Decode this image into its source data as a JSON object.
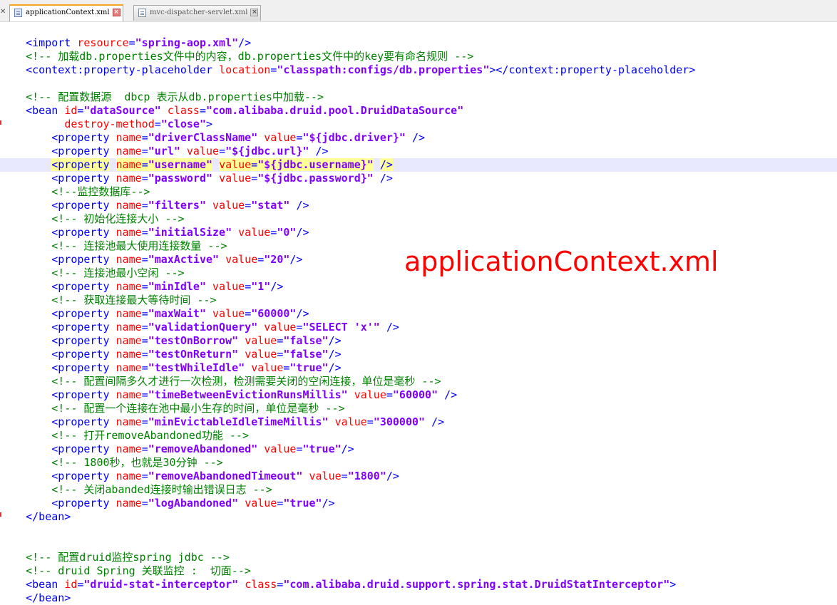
{
  "colors": {
    "tag": "#0000ff",
    "attribute": "#ff0000",
    "value": "#8000ff",
    "comment": "#008000",
    "highlight_line": "#e8e8ff",
    "overlay": "#ff0000"
  },
  "tabs": [
    {
      "label": "applicationContext.xml",
      "active": true,
      "icon": "xml-file-icon"
    },
    {
      "label": "mvc-dispatcher-servlet.xml",
      "active": false,
      "icon": "xml-file-icon"
    }
  ],
  "overlay_text": "applicationContext.xml",
  "lines": [
    [],
    [
      {
        "t": "text",
        "v": "    "
      },
      {
        "t": "tag",
        "v": "<import"
      },
      {
        "t": "text",
        "v": " "
      },
      {
        "t": "attr",
        "v": "resource"
      },
      {
        "t": "tag",
        "v": "="
      },
      {
        "t": "val",
        "v": "\"spring-aop.xml\""
      },
      {
        "t": "tag",
        "v": "/>"
      }
    ],
    [
      {
        "t": "text",
        "v": "    "
      },
      {
        "t": "comment",
        "v": "<!-- 加载db.properties文件中的内容，db.properties文件中的key要有命名规则 -->"
      }
    ],
    [
      {
        "t": "text",
        "v": "    "
      },
      {
        "t": "tag",
        "v": "<context:property-placeholder"
      },
      {
        "t": "text",
        "v": " "
      },
      {
        "t": "attr",
        "v": "location"
      },
      {
        "t": "tag",
        "v": "="
      },
      {
        "t": "val",
        "v": "\"classpath:configs/db.properties\""
      },
      {
        "t": "tag",
        "v": "></context:property-placeholder>"
      }
    ],
    [],
    [
      {
        "t": "text",
        "v": "    "
      },
      {
        "t": "comment",
        "v": "<!-- 配置数据源  dbcp 表示从db.properties中加载-->"
      }
    ],
    [
      {
        "t": "text",
        "v": "    "
      },
      {
        "t": "tag",
        "v": "<bean"
      },
      {
        "t": "text",
        "v": " "
      },
      {
        "t": "attr",
        "v": "id"
      },
      {
        "t": "tag",
        "v": "="
      },
      {
        "t": "val",
        "v": "\"dataSource\""
      },
      {
        "t": "text",
        "v": " "
      },
      {
        "t": "attr",
        "v": "class"
      },
      {
        "t": "tag",
        "v": "="
      },
      {
        "t": "val",
        "v": "\"com.alibaba.druid.pool.DruidDataSource\""
      }
    ],
    [
      {
        "t": "text",
        "v": "          "
      },
      {
        "t": "attr",
        "v": "destroy-method"
      },
      {
        "t": "tag",
        "v": "="
      },
      {
        "t": "val",
        "v": "\"close\""
      },
      {
        "t": "tag",
        "v": ">"
      }
    ],
    [
      {
        "t": "text",
        "v": "        "
      },
      {
        "t": "tag",
        "v": "<property"
      },
      {
        "t": "text",
        "v": " "
      },
      {
        "t": "attr",
        "v": "name"
      },
      {
        "t": "tag",
        "v": "="
      },
      {
        "t": "val",
        "v": "\"driverClassName\""
      },
      {
        "t": "text",
        "v": " "
      },
      {
        "t": "attr",
        "v": "value"
      },
      {
        "t": "tag",
        "v": "="
      },
      {
        "t": "val",
        "v": "\"${jdbc.driver}\""
      },
      {
        "t": "text",
        "v": " "
      },
      {
        "t": "tag",
        "v": "/>"
      }
    ],
    [
      {
        "t": "text",
        "v": "        "
      },
      {
        "t": "tag",
        "v": "<property"
      },
      {
        "t": "text",
        "v": " "
      },
      {
        "t": "attr",
        "v": "name"
      },
      {
        "t": "tag",
        "v": "="
      },
      {
        "t": "val",
        "v": "\"url\""
      },
      {
        "t": "text",
        "v": " "
      },
      {
        "t": "attr",
        "v": "value"
      },
      {
        "t": "tag",
        "v": "="
      },
      {
        "t": "val",
        "v": "\"${jdbc.url}\""
      },
      {
        "t": "text",
        "v": " "
      },
      {
        "t": "tag",
        "v": "/>"
      }
    ],
    [
      {
        "t": "text",
        "v": "        "
      },
      {
        "t": "tag",
        "v": "<property",
        "s": 1
      },
      {
        "t": "text",
        "v": " "
      },
      {
        "t": "attr",
        "v": "name",
        "s": 1
      },
      {
        "t": "tag",
        "v": "=",
        "s": 1
      },
      {
        "t": "val",
        "v": "\"username\"",
        "s": 1
      },
      {
        "t": "text",
        "v": " "
      },
      {
        "t": "attr",
        "v": "value",
        "s": 1
      },
      {
        "t": "tag",
        "v": "=",
        "s": 1
      },
      {
        "t": "val",
        "v": "\"${jdbc.username}\"",
        "s": 1
      },
      {
        "t": "text",
        "v": " "
      },
      {
        "t": "tag",
        "v": "/>",
        "s": 1
      }
    ],
    [
      {
        "t": "text",
        "v": "        "
      },
      {
        "t": "tag",
        "v": "<property"
      },
      {
        "t": "text",
        "v": " "
      },
      {
        "t": "attr",
        "v": "name"
      },
      {
        "t": "tag",
        "v": "="
      },
      {
        "t": "val",
        "v": "\"password\""
      },
      {
        "t": "text",
        "v": " "
      },
      {
        "t": "attr",
        "v": "value"
      },
      {
        "t": "tag",
        "v": "="
      },
      {
        "t": "val",
        "v": "\"${jdbc.password}\""
      },
      {
        "t": "text",
        "v": " "
      },
      {
        "t": "tag",
        "v": "/>"
      }
    ],
    [
      {
        "t": "text",
        "v": "        "
      },
      {
        "t": "comment",
        "v": "<!--监控数据库-->"
      }
    ],
    [
      {
        "t": "text",
        "v": "        "
      },
      {
        "t": "tag",
        "v": "<property"
      },
      {
        "t": "text",
        "v": " "
      },
      {
        "t": "attr",
        "v": "name"
      },
      {
        "t": "tag",
        "v": "="
      },
      {
        "t": "val",
        "v": "\"filters\""
      },
      {
        "t": "text",
        "v": " "
      },
      {
        "t": "attr",
        "v": "value"
      },
      {
        "t": "tag",
        "v": "="
      },
      {
        "t": "val",
        "v": "\"stat\""
      },
      {
        "t": "text",
        "v": " "
      },
      {
        "t": "tag",
        "v": "/>"
      }
    ],
    [
      {
        "t": "text",
        "v": "        "
      },
      {
        "t": "comment",
        "v": "<!-- 初始化连接大小 -->"
      }
    ],
    [
      {
        "t": "text",
        "v": "        "
      },
      {
        "t": "tag",
        "v": "<property"
      },
      {
        "t": "text",
        "v": " "
      },
      {
        "t": "attr",
        "v": "name"
      },
      {
        "t": "tag",
        "v": "="
      },
      {
        "t": "val",
        "v": "\"initialSize\""
      },
      {
        "t": "text",
        "v": " "
      },
      {
        "t": "attr",
        "v": "value"
      },
      {
        "t": "tag",
        "v": "="
      },
      {
        "t": "val",
        "v": "\"0\""
      },
      {
        "t": "tag",
        "v": "/>"
      }
    ],
    [
      {
        "t": "text",
        "v": "        "
      },
      {
        "t": "comment",
        "v": "<!-- 连接池最大使用连接数量 -->"
      }
    ],
    [
      {
        "t": "text",
        "v": "        "
      },
      {
        "t": "tag",
        "v": "<property"
      },
      {
        "t": "text",
        "v": " "
      },
      {
        "t": "attr",
        "v": "name"
      },
      {
        "t": "tag",
        "v": "="
      },
      {
        "t": "val",
        "v": "\"maxActive\""
      },
      {
        "t": "text",
        "v": " "
      },
      {
        "t": "attr",
        "v": "value"
      },
      {
        "t": "tag",
        "v": "="
      },
      {
        "t": "val",
        "v": "\"20\""
      },
      {
        "t": "tag",
        "v": "/>"
      }
    ],
    [
      {
        "t": "text",
        "v": "        "
      },
      {
        "t": "comment",
        "v": "<!-- 连接池最小空闲 -->"
      }
    ],
    [
      {
        "t": "text",
        "v": "        "
      },
      {
        "t": "tag",
        "v": "<property"
      },
      {
        "t": "text",
        "v": " "
      },
      {
        "t": "attr",
        "v": "name"
      },
      {
        "t": "tag",
        "v": "="
      },
      {
        "t": "val",
        "v": "\"minIdle\""
      },
      {
        "t": "text",
        "v": " "
      },
      {
        "t": "attr",
        "v": "value"
      },
      {
        "t": "tag",
        "v": "="
      },
      {
        "t": "val",
        "v": "\"1\""
      },
      {
        "t": "tag",
        "v": "/>"
      }
    ],
    [
      {
        "t": "text",
        "v": "        "
      },
      {
        "t": "comment",
        "v": "<!-- 获取连接最大等待时间 -->"
      }
    ],
    [
      {
        "t": "text",
        "v": "        "
      },
      {
        "t": "tag",
        "v": "<property"
      },
      {
        "t": "text",
        "v": " "
      },
      {
        "t": "attr",
        "v": "name"
      },
      {
        "t": "tag",
        "v": "="
      },
      {
        "t": "val",
        "v": "\"maxWait\""
      },
      {
        "t": "text",
        "v": " "
      },
      {
        "t": "attr",
        "v": "value"
      },
      {
        "t": "tag",
        "v": "="
      },
      {
        "t": "val",
        "v": "\"60000\""
      },
      {
        "t": "tag",
        "v": "/>"
      }
    ],
    [
      {
        "t": "text",
        "v": "        "
      },
      {
        "t": "tag",
        "v": "<property"
      },
      {
        "t": "text",
        "v": " "
      },
      {
        "t": "attr",
        "v": "name"
      },
      {
        "t": "tag",
        "v": "="
      },
      {
        "t": "val",
        "v": "\"validationQuery\""
      },
      {
        "t": "text",
        "v": " "
      },
      {
        "t": "attr",
        "v": "value"
      },
      {
        "t": "tag",
        "v": "="
      },
      {
        "t": "val",
        "v": "\"SELECT 'x'\""
      },
      {
        "t": "text",
        "v": " "
      },
      {
        "t": "tag",
        "v": "/>"
      }
    ],
    [
      {
        "t": "text",
        "v": "        "
      },
      {
        "t": "tag",
        "v": "<property"
      },
      {
        "t": "text",
        "v": " "
      },
      {
        "t": "attr",
        "v": "name"
      },
      {
        "t": "tag",
        "v": "="
      },
      {
        "t": "val",
        "v": "\"testOnBorrow\""
      },
      {
        "t": "text",
        "v": " "
      },
      {
        "t": "attr",
        "v": "value"
      },
      {
        "t": "tag",
        "v": "="
      },
      {
        "t": "val",
        "v": "\"false\""
      },
      {
        "t": "tag",
        "v": "/>"
      }
    ],
    [
      {
        "t": "text",
        "v": "        "
      },
      {
        "t": "tag",
        "v": "<property"
      },
      {
        "t": "text",
        "v": " "
      },
      {
        "t": "attr",
        "v": "name"
      },
      {
        "t": "tag",
        "v": "="
      },
      {
        "t": "val",
        "v": "\"testOnReturn\""
      },
      {
        "t": "text",
        "v": " "
      },
      {
        "t": "attr",
        "v": "value"
      },
      {
        "t": "tag",
        "v": "="
      },
      {
        "t": "val",
        "v": "\"false\""
      },
      {
        "t": "tag",
        "v": "/>"
      }
    ],
    [
      {
        "t": "text",
        "v": "        "
      },
      {
        "t": "tag",
        "v": "<property"
      },
      {
        "t": "text",
        "v": " "
      },
      {
        "t": "attr",
        "v": "name"
      },
      {
        "t": "tag",
        "v": "="
      },
      {
        "t": "val",
        "v": "\"testWhileIdle\""
      },
      {
        "t": "text",
        "v": " "
      },
      {
        "t": "attr",
        "v": "value"
      },
      {
        "t": "tag",
        "v": "="
      },
      {
        "t": "val",
        "v": "\"true\""
      },
      {
        "t": "tag",
        "v": "/>"
      }
    ],
    [
      {
        "t": "text",
        "v": "        "
      },
      {
        "t": "comment",
        "v": "<!-- 配置间隔多久才进行一次检测，检测需要关闭的空闲连接，单位是毫秒 -->"
      }
    ],
    [
      {
        "t": "text",
        "v": "        "
      },
      {
        "t": "tag",
        "v": "<property"
      },
      {
        "t": "text",
        "v": " "
      },
      {
        "t": "attr",
        "v": "name"
      },
      {
        "t": "tag",
        "v": "="
      },
      {
        "t": "val",
        "v": "\"timeBetweenEvictionRunsMillis\""
      },
      {
        "t": "text",
        "v": " "
      },
      {
        "t": "attr",
        "v": "value"
      },
      {
        "t": "tag",
        "v": "="
      },
      {
        "t": "val",
        "v": "\"60000\""
      },
      {
        "t": "text",
        "v": " "
      },
      {
        "t": "tag",
        "v": "/>"
      }
    ],
    [
      {
        "t": "text",
        "v": "        "
      },
      {
        "t": "comment",
        "v": "<!-- 配置一个连接在池中最小生存的时间，单位是毫秒 -->"
      }
    ],
    [
      {
        "t": "text",
        "v": "        "
      },
      {
        "t": "tag",
        "v": "<property"
      },
      {
        "t": "text",
        "v": " "
      },
      {
        "t": "attr",
        "v": "name"
      },
      {
        "t": "tag",
        "v": "="
      },
      {
        "t": "val",
        "v": "\"minEvictableIdleTimeMillis\""
      },
      {
        "t": "text",
        "v": " "
      },
      {
        "t": "attr",
        "v": "value"
      },
      {
        "t": "tag",
        "v": "="
      },
      {
        "t": "val",
        "v": "\"300000\""
      },
      {
        "t": "text",
        "v": " "
      },
      {
        "t": "tag",
        "v": "/>"
      }
    ],
    [
      {
        "t": "text",
        "v": "        "
      },
      {
        "t": "comment",
        "v": "<!-- 打开removeAbandoned功能 -->"
      }
    ],
    [
      {
        "t": "text",
        "v": "        "
      },
      {
        "t": "tag",
        "v": "<property"
      },
      {
        "t": "text",
        "v": " "
      },
      {
        "t": "attr",
        "v": "name"
      },
      {
        "t": "tag",
        "v": "="
      },
      {
        "t": "val",
        "v": "\"removeAbandoned\""
      },
      {
        "t": "text",
        "v": " "
      },
      {
        "t": "attr",
        "v": "value"
      },
      {
        "t": "tag",
        "v": "="
      },
      {
        "t": "val",
        "v": "\"true\""
      },
      {
        "t": "tag",
        "v": "/>"
      }
    ],
    [
      {
        "t": "text",
        "v": "        "
      },
      {
        "t": "comment",
        "v": "<!-- 1800秒，也就是30分钟 -->"
      }
    ],
    [
      {
        "t": "text",
        "v": "        "
      },
      {
        "t": "tag",
        "v": "<property"
      },
      {
        "t": "text",
        "v": " "
      },
      {
        "t": "attr",
        "v": "name"
      },
      {
        "t": "tag",
        "v": "="
      },
      {
        "t": "val",
        "v": "\"removeAbandonedTimeout\""
      },
      {
        "t": "text",
        "v": " "
      },
      {
        "t": "attr",
        "v": "value"
      },
      {
        "t": "tag",
        "v": "="
      },
      {
        "t": "val",
        "v": "\"1800\""
      },
      {
        "t": "tag",
        "v": "/>"
      }
    ],
    [
      {
        "t": "text",
        "v": "        "
      },
      {
        "t": "comment",
        "v": "<!-- 关闭abanded连接时输出错误日志 -->"
      }
    ],
    [
      {
        "t": "text",
        "v": "        "
      },
      {
        "t": "tag",
        "v": "<property"
      },
      {
        "t": "text",
        "v": " "
      },
      {
        "t": "attr",
        "v": "name"
      },
      {
        "t": "tag",
        "v": "="
      },
      {
        "t": "val",
        "v": "\"logAbandoned\""
      },
      {
        "t": "text",
        "v": " "
      },
      {
        "t": "attr",
        "v": "value"
      },
      {
        "t": "tag",
        "v": "="
      },
      {
        "t": "val",
        "v": "\"true\""
      },
      {
        "t": "tag",
        "v": "/>"
      }
    ],
    [
      {
        "t": "text",
        "v": "    "
      },
      {
        "t": "tag",
        "v": "</bean>"
      }
    ],
    [],
    [],
    [
      {
        "t": "text",
        "v": "    "
      },
      {
        "t": "comment",
        "v": "<!-- 配置druid监控spring jdbc -->"
      }
    ],
    [
      {
        "t": "text",
        "v": "    "
      },
      {
        "t": "comment",
        "v": "<!-- druid Spring 关联监控 :  切面-->"
      }
    ],
    [
      {
        "t": "text",
        "v": "    "
      },
      {
        "t": "tag",
        "v": "<bean"
      },
      {
        "t": "text",
        "v": " "
      },
      {
        "t": "attr",
        "v": "id"
      },
      {
        "t": "tag",
        "v": "="
      },
      {
        "t": "val",
        "v": "\"druid-stat-interceptor\""
      },
      {
        "t": "text",
        "v": " "
      },
      {
        "t": "attr",
        "v": "class"
      },
      {
        "t": "tag",
        "v": "="
      },
      {
        "t": "val",
        "v": "\"com.alibaba.druid.support.spring.stat.DruidStatInterceptor\""
      },
      {
        "t": "tag",
        "v": ">"
      }
    ],
    [
      {
        "t": "text",
        "v": "    "
      },
      {
        "t": "tag",
        "v": "</bean>"
      }
    ]
  ]
}
